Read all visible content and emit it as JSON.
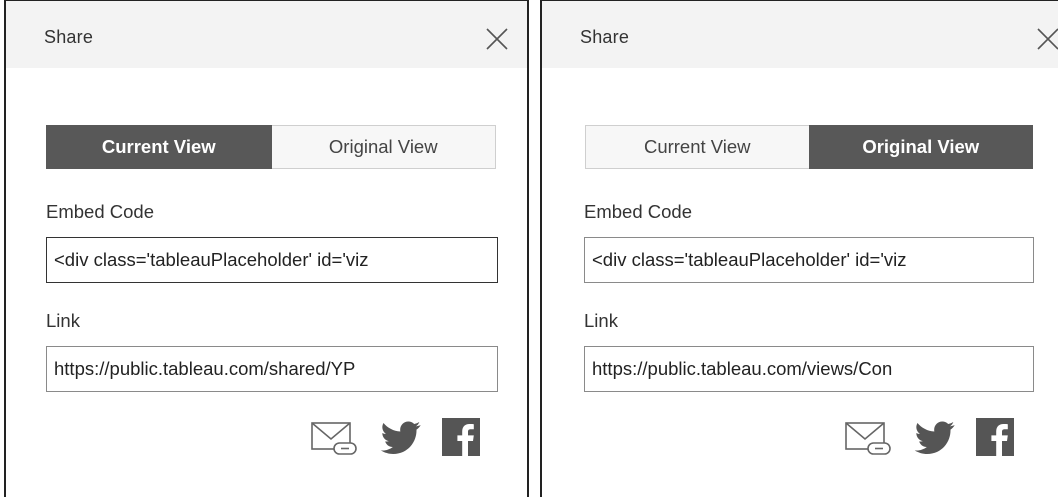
{
  "panels": [
    {
      "title": "Share",
      "tabs": [
        {
          "label": "Current View",
          "active": true
        },
        {
          "label": "Original View",
          "active": false
        }
      ],
      "embed_label": "Embed Code",
      "embed_value": "<div class='tableauPlaceholder' id='viz",
      "link_label": "Link",
      "link_value": "https://public.tableau.com/shared/YP"
    },
    {
      "title": "Share",
      "tabs": [
        {
          "label": "Current View",
          "active": false
        },
        {
          "label": "Original View",
          "active": true
        }
      ],
      "embed_label": "Embed Code",
      "embed_value": "<div class='tableauPlaceholder' id='viz",
      "link_label": "Link",
      "link_value": "https://public.tableau.com/views/Con"
    }
  ],
  "icons": {
    "close": "close-icon",
    "email": "email-link-icon",
    "twitter": "twitter-icon",
    "facebook": "facebook-icon"
  },
  "colors": {
    "active_tab_bg": "#585858",
    "inactive_tab_bg": "#f7f7f7",
    "header_bg": "#f3f3f3",
    "icon_color": "#555555"
  }
}
